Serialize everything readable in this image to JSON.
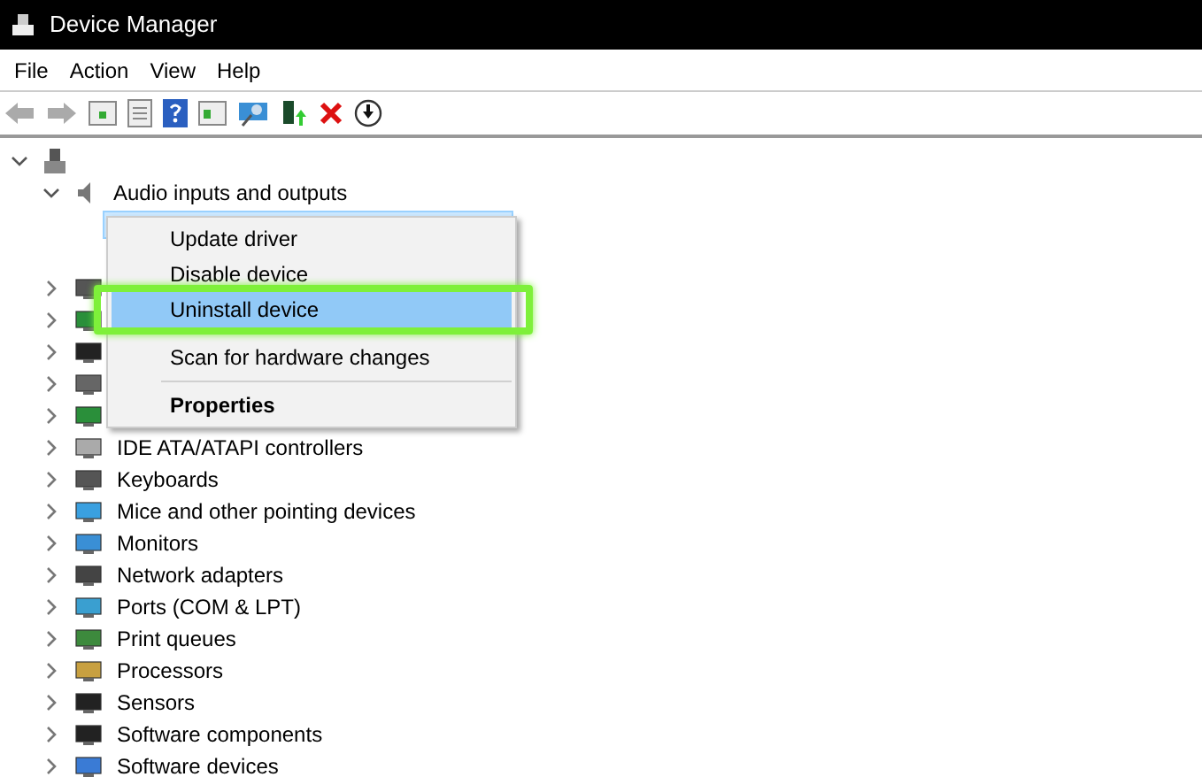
{
  "window": {
    "title": "Device Manager"
  },
  "menu_bar": [
    "File",
    "Action",
    "View",
    "Help"
  ],
  "tree": [
    {
      "expanded": true,
      "children": [
        {
          "label": "Audio inputs and outputs",
          "expanded": true,
          "children": [
            {
              "selected": true
            }
          ]
        },
        {
          "expanded": false
        },
        {
          "expanded": false
        },
        {
          "expanded": false
        },
        {
          "expanded": false
        },
        {
          "expanded": false
        },
        {
          "label": "IDE ATA/ATAPI controllers",
          "expanded": false
        },
        {
          "label": "Keyboards",
          "expanded": false
        },
        {
          "label": "Mice and other pointing devices",
          "expanded": false
        },
        {
          "label": "Monitors",
          "expanded": false
        },
        {
          "label": "Network adapters",
          "expanded": false
        },
        {
          "label": "Ports (COM & LPT)",
          "expanded": false
        },
        {
          "label": "Print queues",
          "expanded": false
        },
        {
          "label": "Processors",
          "expanded": false
        },
        {
          "label": "Sensors",
          "expanded": false
        },
        {
          "label": "Software components",
          "expanded": false
        },
        {
          "label": "Software devices",
          "expanded": false
        }
      ]
    }
  ],
  "context_menu": [
    {
      "label": "Update driver",
      "selected": false,
      "highlighted": false,
      "bold": false
    },
    {
      "label": "Disable device",
      "selected": false,
      "highlighted": false,
      "bold": false
    },
    {
      "label": "Uninstall device",
      "selected": true,
      "highlighted": true,
      "bold": false
    },
    {
      "kind": "separator"
    },
    {
      "label": "Scan for hardware changes",
      "selected": false,
      "highlighted": false,
      "bold": false
    },
    {
      "kind": "separator"
    },
    {
      "label": "Properties",
      "selected": false,
      "highlighted": false,
      "bold": true
    }
  ]
}
